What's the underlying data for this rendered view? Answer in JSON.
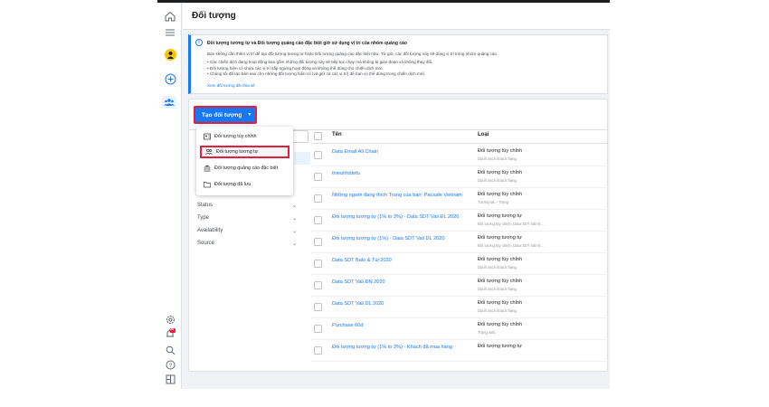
{
  "page": {
    "title": "Đối tượng"
  },
  "rail": {
    "icons": [
      "home-icon",
      "menu-icon",
      "avatar-icon",
      "add-icon",
      "audience-icon",
      "settings-icon",
      "notifications-icon",
      "search-icon",
      "help-icon",
      "panel-icon"
    ],
    "notification_badge": "28"
  },
  "info": {
    "heading": "Đối tượng tương tự và Đối tượng quảng cáo đặc biệt giờ sử dụng vị trí của nhóm quảng cáo",
    "paragraph": "Bạn không cần thêm vị trí để tạo đối tượng tương tự hoặc Đối tượng quảng cáo đặc biệt nữa. Từ giờ, các đối tượng này sẽ dùng vị trí trong nhóm quảng cáo",
    "bullets": [
      "Các chiến dịch đang hoạt động bao gồm những đối tượng này sẽ tiếp tục chạy mà không bị gián đoạn và không thay đổi.",
      "Đối tượng hiện có chứa các vị trí sắp ngừng hoạt động và không thể dùng cho chiến dịch mới.",
      "Chúng tôi đã tạo bản sao cho những đối tượng hiện có (và giữ cả các vị trí) để bạn có thể dùng trong chiến dịch mới."
    ],
    "link": "Xem đối tượng đã chia sẻ"
  },
  "create_button": {
    "label": "Tạo đối tượng",
    "caret": "▼"
  },
  "dropdown": {
    "items": [
      {
        "label": "Đối tượng tùy chỉnh",
        "icon": "contact-card-icon"
      },
      {
        "label": "Đối tượng tương tự",
        "icon": "people-icon"
      },
      {
        "label": "Đối tượng quảng cáo đặc biệt",
        "icon": "bank-icon"
      },
      {
        "label": "Đối tượng đã lưu",
        "icon": "folder-icon"
      }
    ]
  },
  "search_stub": "g",
  "filters": [
    {
      "label": "Status"
    },
    {
      "label": "Type"
    },
    {
      "label": "Availability"
    },
    {
      "label": "Source"
    }
  ],
  "table": {
    "headers": {
      "name": "Tên",
      "type": "Loại"
    },
    "rows": [
      {
        "name": "Data Email All Chain",
        "type": "Đối tượng tùy chỉnh",
        "sub": "Danh sách khách hàng"
      },
      {
        "name": "thieuhhtdefu",
        "type": "Đối tượng tùy chỉnh",
        "sub": "Danh sách khách hàng"
      },
      {
        "name": "Những người đang thích Trang của bạn: Pacsafe Vietnam",
        "type": "Đối tượng tùy chỉnh",
        "sub": "Tương tác - Trang"
      },
      {
        "name": "Đối tượng tương tự (1% to 3%) - Data SDT Vali ĐL 2020",
        "type": "Đối tượng tương tự",
        "sub": "Đối tượng tùy chỉnh: Data SDT Vali Đ..."
      },
      {
        "name": "Đối tượng tương tự (1%) - Data SDT Vali DL 2020",
        "type": "Đối tượng tương tự",
        "sub": "Đối tượng tùy chỉnh: Data SDT Vali Đ..."
      },
      {
        "name": "Data SDT Balo & Túi 2020",
        "type": "Đối tượng tùy chỉnh",
        "sub": "Danh sách khách hàng"
      },
      {
        "name": "Data SDT Vali ĐN 2020",
        "type": "Đối tượng tùy chỉnh",
        "sub": "Danh sách khách hàng"
      },
      {
        "name": "Data SDT Vali DL 2020",
        "type": "Đối tượng tùy chỉnh",
        "sub": "Danh sách khách hàng"
      },
      {
        "name": "Purchase 60d",
        "type": "Đối tượng tùy chỉnh",
        "sub": "Trang web"
      },
      {
        "name": "Đối tượng tương tự (1% to 3%) - Khách đã mua hàng",
        "type": "Đối tượng tương tự",
        "sub": ""
      }
    ]
  },
  "colors": {
    "accent": "#1877f2",
    "highlight": "#e41e3f"
  }
}
